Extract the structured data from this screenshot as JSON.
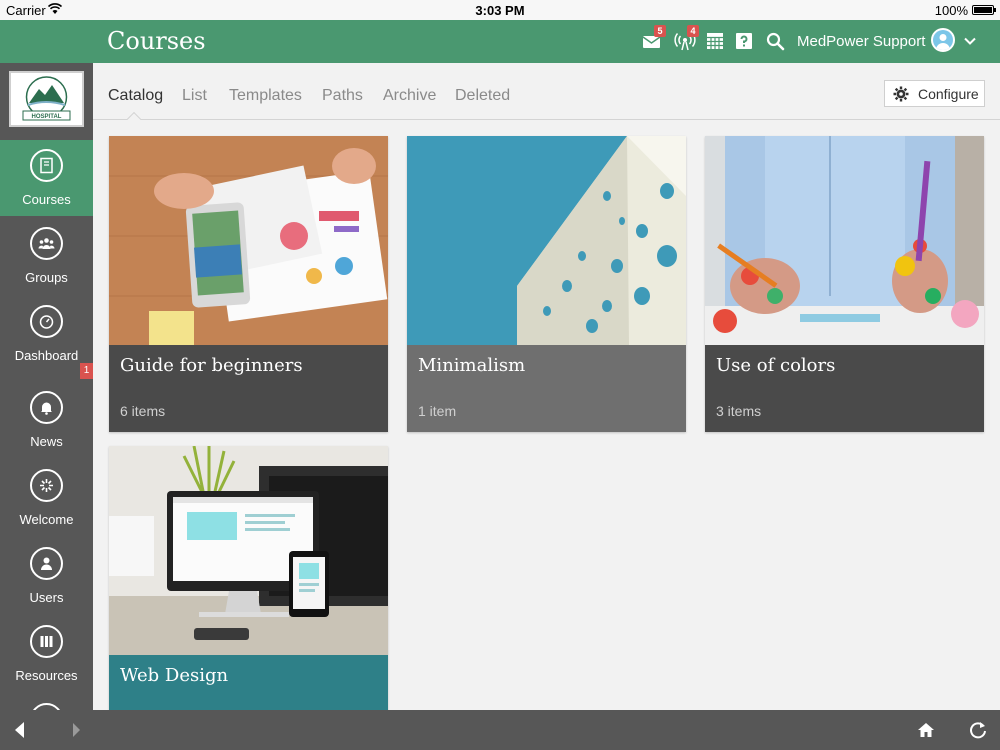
{
  "status_bar": {
    "carrier": "Carrier",
    "time": "3:03 PM",
    "battery": "100%"
  },
  "header": {
    "title": "Courses",
    "mail_badge": "5",
    "broadcast_badge": "4",
    "user_name": "MedPower Support"
  },
  "sidebar": {
    "logo_text": "HOSPITAL",
    "items": [
      {
        "label": "Courses",
        "icon": "book-icon"
      },
      {
        "label": "Groups",
        "icon": "groups-icon"
      },
      {
        "label": "Dashboard",
        "icon": "speedometer-icon"
      },
      {
        "label": "News",
        "icon": "bell-icon"
      },
      {
        "label": "Welcome",
        "icon": "sparkle-icon"
      },
      {
        "label": "Users",
        "icon": "user-icon"
      },
      {
        "label": "Resources",
        "icon": "library-icon"
      }
    ],
    "dashboard_badge": "1"
  },
  "tabs": [
    "Catalog",
    "List",
    "Templates",
    "Paths",
    "Archive",
    "Deleted"
  ],
  "configure_label": "Configure",
  "cards": [
    {
      "title": "Guide for beginners",
      "count": "6 items"
    },
    {
      "title": "Minimalism",
      "count": "1 item"
    },
    {
      "title": "Use of colors",
      "count": "3 items"
    },
    {
      "title": "Web Design",
      "count": ""
    }
  ],
  "colors": {
    "brand_green": "#4a9870",
    "sidebar_gray": "#575757",
    "badge_red": "#d9534f",
    "web_design_teal": "#2e8088"
  }
}
